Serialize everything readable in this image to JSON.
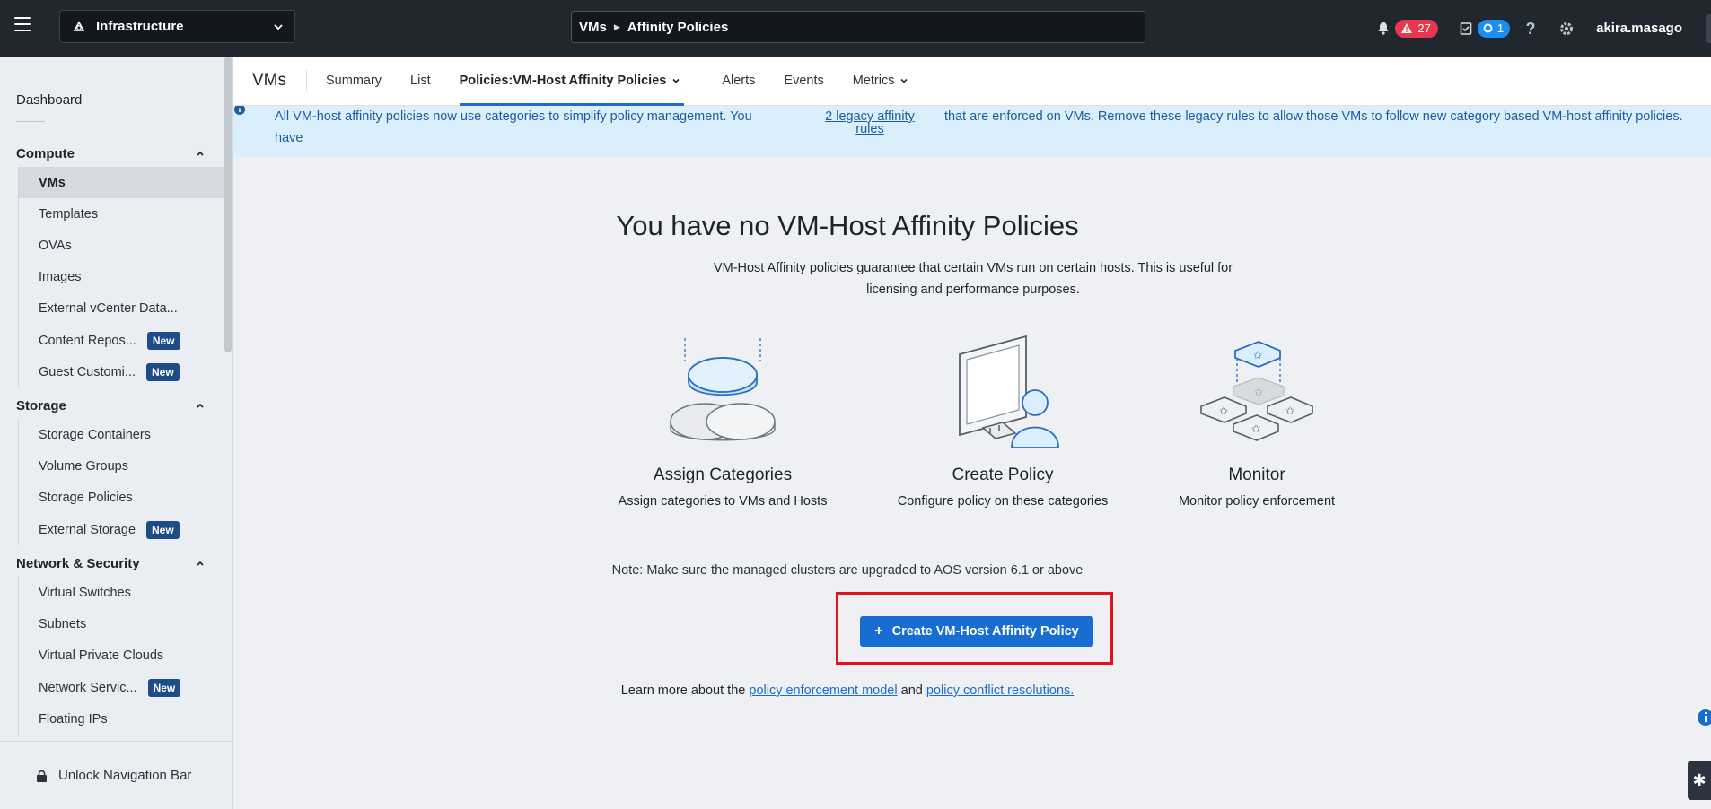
{
  "topbar": {
    "app_name": "Infrastructure",
    "breadcrumb": [
      "VMs",
      "Affinity Policies"
    ],
    "alert_count": "27",
    "task_count": "1",
    "username": "akira.masago"
  },
  "sidebar": {
    "dashboard": "Dashboard",
    "compute": {
      "title": "Compute",
      "items": [
        "VMs",
        "Templates",
        "OVAs",
        "Images",
        "External vCenter Data...",
        "Content Repos...",
        "Guest Customi..."
      ]
    },
    "storage": {
      "title": "Storage",
      "items": [
        "Storage Containers",
        "Volume Groups",
        "Storage Policies",
        "External Storage"
      ]
    },
    "network": {
      "title": "Network & Security",
      "items": [
        "Virtual Switches",
        "Subnets",
        "Virtual Private Clouds",
        "Network Servic...",
        "Floating IPs"
      ]
    },
    "new_badge": "New",
    "unlock": "Unlock Navigation Bar"
  },
  "subnav": {
    "title": "VMs",
    "tabs": [
      "Summary",
      "List",
      "Policies:VM-Host Affinity Policies",
      "Alerts",
      "Events",
      "Metrics"
    ]
  },
  "banner": {
    "text_before": "All VM-host affinity policies now use categories to simplify policy management. You have",
    "link": "2 legacy affinity rules",
    "text_after": "that are enforced on VMs. Remove these legacy rules to allow those VMs to follow new category based VM-host affinity policies."
  },
  "empty": {
    "title": "You have no VM-Host Affinity Policies",
    "description": "VM-Host Affinity policies guarantee that certain VMs run on certain hosts. This is useful for licensing and performance purposes.",
    "steps": [
      {
        "title": "Assign Categories",
        "desc": "Assign categories to VMs and Hosts"
      },
      {
        "title": "Create Policy",
        "desc": "Configure policy on these categories"
      },
      {
        "title": "Monitor",
        "desc": "Monitor policy enforcement"
      }
    ],
    "note": "Note: Make sure the managed clusters are upgraded to AOS version 6.1 or above",
    "button": "Create VM-Host Affinity Policy",
    "learn_prefix": "Learn more about the",
    "learn_link1": "policy enforcement model",
    "learn_mid": "and",
    "learn_link2": "policy conflict resolutions."
  },
  "colors": {
    "topbar": "#21272f",
    "primary": "#1a6dd0",
    "alert": "#e8364f",
    "highlight": "#e0141c",
    "banner_bg": "#dbeefc"
  }
}
